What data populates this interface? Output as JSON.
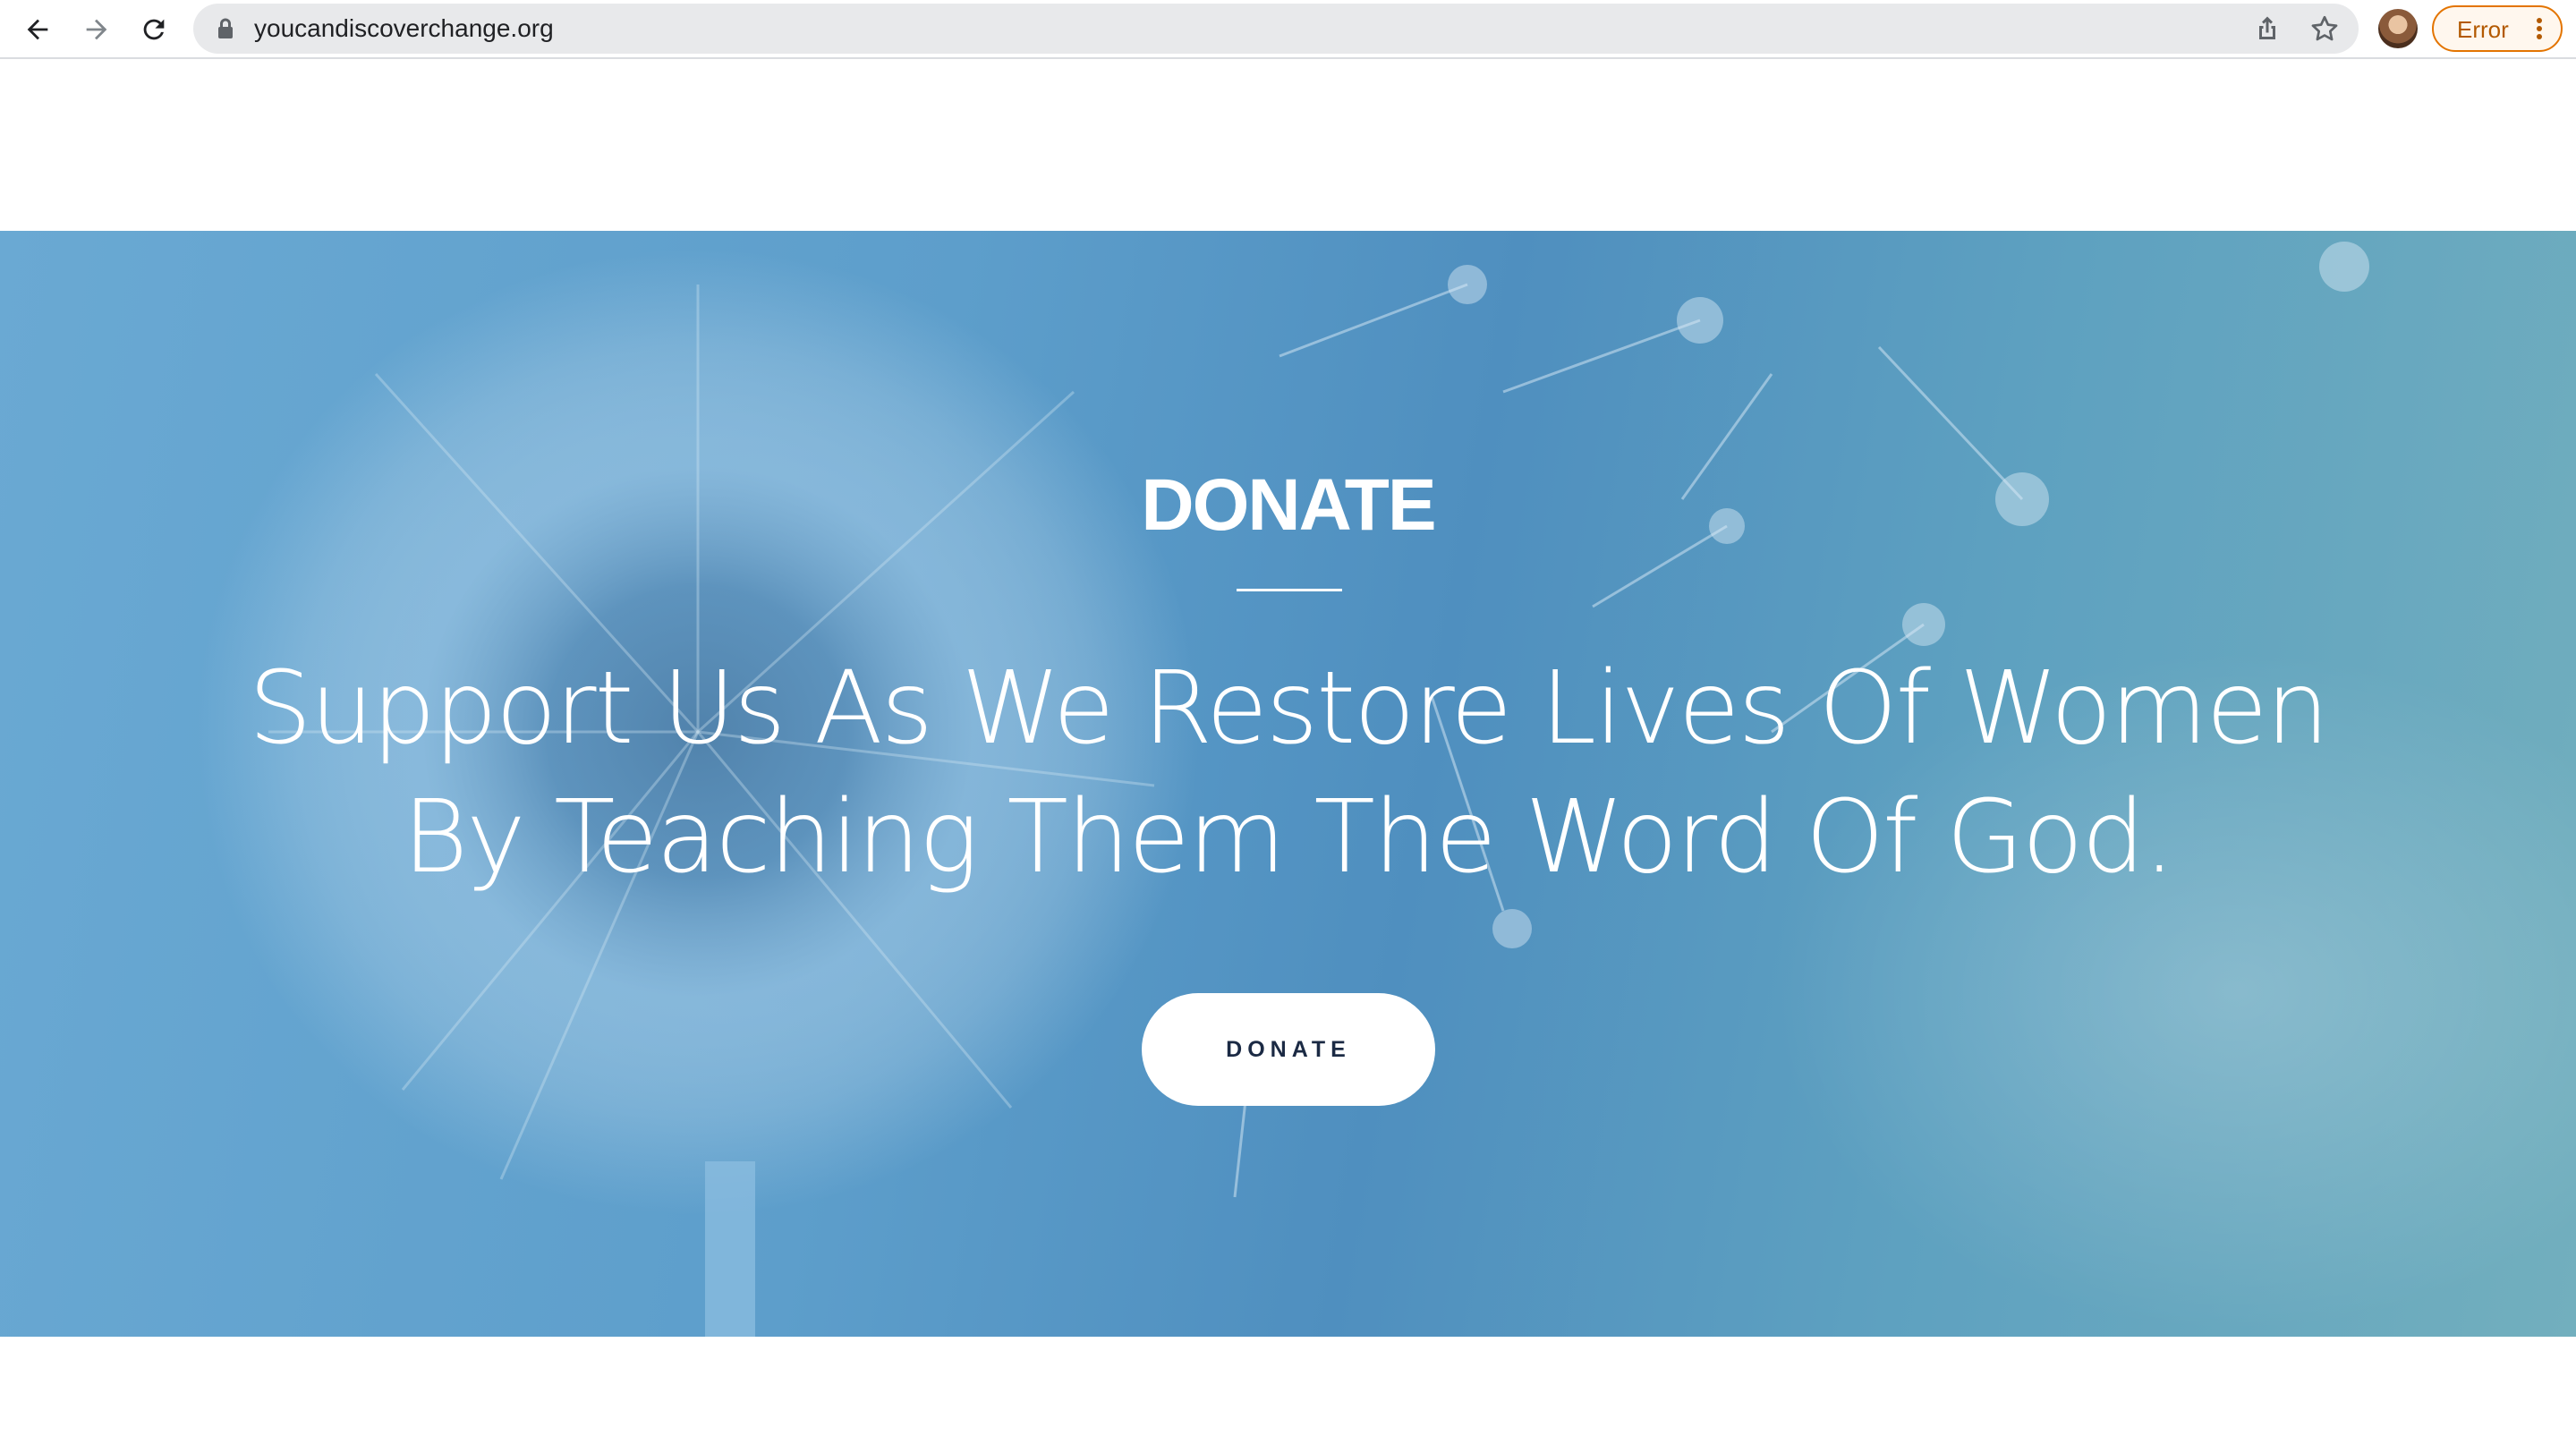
{
  "browser": {
    "url": "youcandiscoverchange.org",
    "error_label": "Error",
    "icons": {
      "back": "back-arrow-icon",
      "forward": "forward-arrow-icon",
      "reload": "reload-icon",
      "lock": "lock-icon",
      "share": "share-icon",
      "bookmark": "star-icon",
      "menu": "more-vert-icon"
    }
  },
  "hero": {
    "title": "DONATE",
    "subtitle": "Support Us As We Restore Lives Of Women By Teaching Them The Word Of God.",
    "button_label": "DONATE",
    "colors": {
      "overlay": "#5d9ecb",
      "text": "#ffffff",
      "button_bg": "#ffffff",
      "button_text": "#1b2a44"
    }
  }
}
